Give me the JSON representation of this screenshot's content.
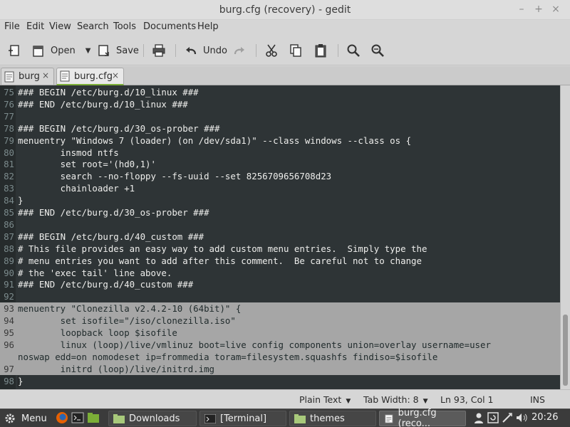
{
  "window": {
    "title": "burg.cfg (recovery) - gedit",
    "controls": {
      "minimize": "–",
      "maximize": "+",
      "close": "×"
    }
  },
  "menubar": [
    "File",
    "Edit",
    "View",
    "Search",
    "Tools",
    "Documents",
    "Help"
  ],
  "toolbar": {
    "open_label": "Open",
    "save_label": "Save",
    "undo_label": "Undo"
  },
  "tabs": [
    {
      "label": "burg",
      "close": "×"
    },
    {
      "label": "burg.cfg",
      "close": "×"
    }
  ],
  "editor": {
    "lines": [
      {
        "num": "75",
        "text": "### BEGIN /etc/burg.d/10_linux ###"
      },
      {
        "num": "76",
        "text": "### END /etc/burg.d/10_linux ###"
      },
      {
        "num": "77",
        "text": ""
      },
      {
        "num": "78",
        "text": "### BEGIN /etc/burg.d/30_os-prober ###"
      },
      {
        "num": "79",
        "text": "menuentry \"Windows 7 (loader) (on /dev/sda1)\" --class windows --class os {"
      },
      {
        "num": "80",
        "text": "        insmod ntfs"
      },
      {
        "num": "81",
        "text": "        set root='(hd0,1)'"
      },
      {
        "num": "82",
        "text": "        search --no-floppy --fs-uuid --set 8256709656708d23"
      },
      {
        "num": "83",
        "text": "        chainloader +1"
      },
      {
        "num": "84",
        "text": "}"
      },
      {
        "num": "85",
        "text": "### END /etc/burg.d/30_os-prober ###"
      },
      {
        "num": "86",
        "text": ""
      },
      {
        "num": "87",
        "text": "### BEGIN /etc/burg.d/40_custom ###"
      },
      {
        "num": "88",
        "text": "# This file provides an easy way to add custom menu entries.  Simply type the"
      },
      {
        "num": "89",
        "text": "# menu entries you want to add after this comment.  Be careful not to change"
      },
      {
        "num": "90",
        "text": "# the 'exec tail' line above."
      },
      {
        "num": "91",
        "text": "### END /etc/burg.d/40_custom ###"
      },
      {
        "num": "92",
        "text": ""
      },
      {
        "num": "93",
        "text": "menuentry \"Clonezilla v2.4.2-10 (64bit)\" {",
        "selected": true
      },
      {
        "num": "94",
        "text": "        set isofile=\"/iso/clonezilla.iso\"",
        "selected": true
      },
      {
        "num": "95",
        "text": "        loopback loop $isofile",
        "selected": true
      },
      {
        "num": "96",
        "text": "        linux (loop)/live/vmlinuz boot=live config components union=overlay username=user",
        "selected": true
      },
      {
        "num": "",
        "text": "noswap edd=on nomodeset ip=frommedia toram=filesystem.squashfs findiso=$isofile",
        "selected": true
      },
      {
        "num": "97",
        "text": "        initrd (loop)/live/initrd.img",
        "selected": true
      },
      {
        "num": "98",
        "text": "}",
        "selected": false
      }
    ]
  },
  "statusbar": {
    "language": "Plain Text",
    "tab_width": "Tab Width:  8",
    "position": "Ln 93, Col 1",
    "mode": "INS"
  },
  "taskbar": {
    "menu_label": "Menu",
    "windows": [
      {
        "label": "Downloads",
        "icon": "folder-icon"
      },
      {
        "label": "[Terminal]",
        "icon": "terminal-icon"
      },
      {
        "label": "themes",
        "icon": "folder-icon"
      },
      {
        "label": "burg.cfg (reco...",
        "icon": "text-editor-icon",
        "active": true
      }
    ],
    "clock": "20:26"
  },
  "colors": {
    "editor_bg": "#2e3436",
    "selection": "#a6a6a6",
    "tab_accent": "#7cae37",
    "taskbar_bg": "#3b3b3b"
  }
}
